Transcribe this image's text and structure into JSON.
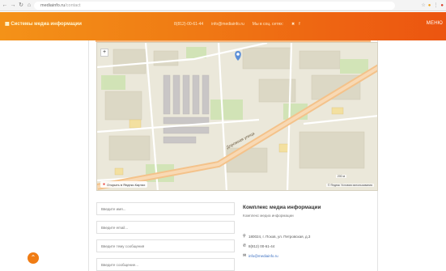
{
  "browser": {
    "back_icon": "back-arrow-icon",
    "url_domain": "mediainfo.ru",
    "url_path": "/contact"
  },
  "header": {
    "brand": "Системы медиа информации",
    "phone": "8(812)-00-61-44",
    "email": "info@mediainfo.ru",
    "social_label": "Мы в соц. сетях:",
    "menu_label": "МЕНЮ",
    "accent_color": "#f07c14"
  },
  "map": {
    "zoom_label": "+",
    "street_label": "Дорожная улица",
    "open_in_maps": "Открыть в Яндекс.Картах",
    "scale_text": "200 м",
    "copyright": "© Яндекс Условия использования"
  },
  "form": {
    "name_placeholder": "Введите имя...",
    "email_placeholder": "Введите email...",
    "subject_placeholder": "Введите тему сообщения",
    "message_placeholder": "Введите сообщение..."
  },
  "info": {
    "title": "Комплекс медиа информации",
    "subtitle": "Комплекс медиа информации",
    "address": "180024, г. Псков, ул. Петровская, д.3",
    "phone": "8(812) 00-61-44",
    "email": "info@mediainfo.ru"
  },
  "scroll_top_icon": "chevron-up-icon"
}
